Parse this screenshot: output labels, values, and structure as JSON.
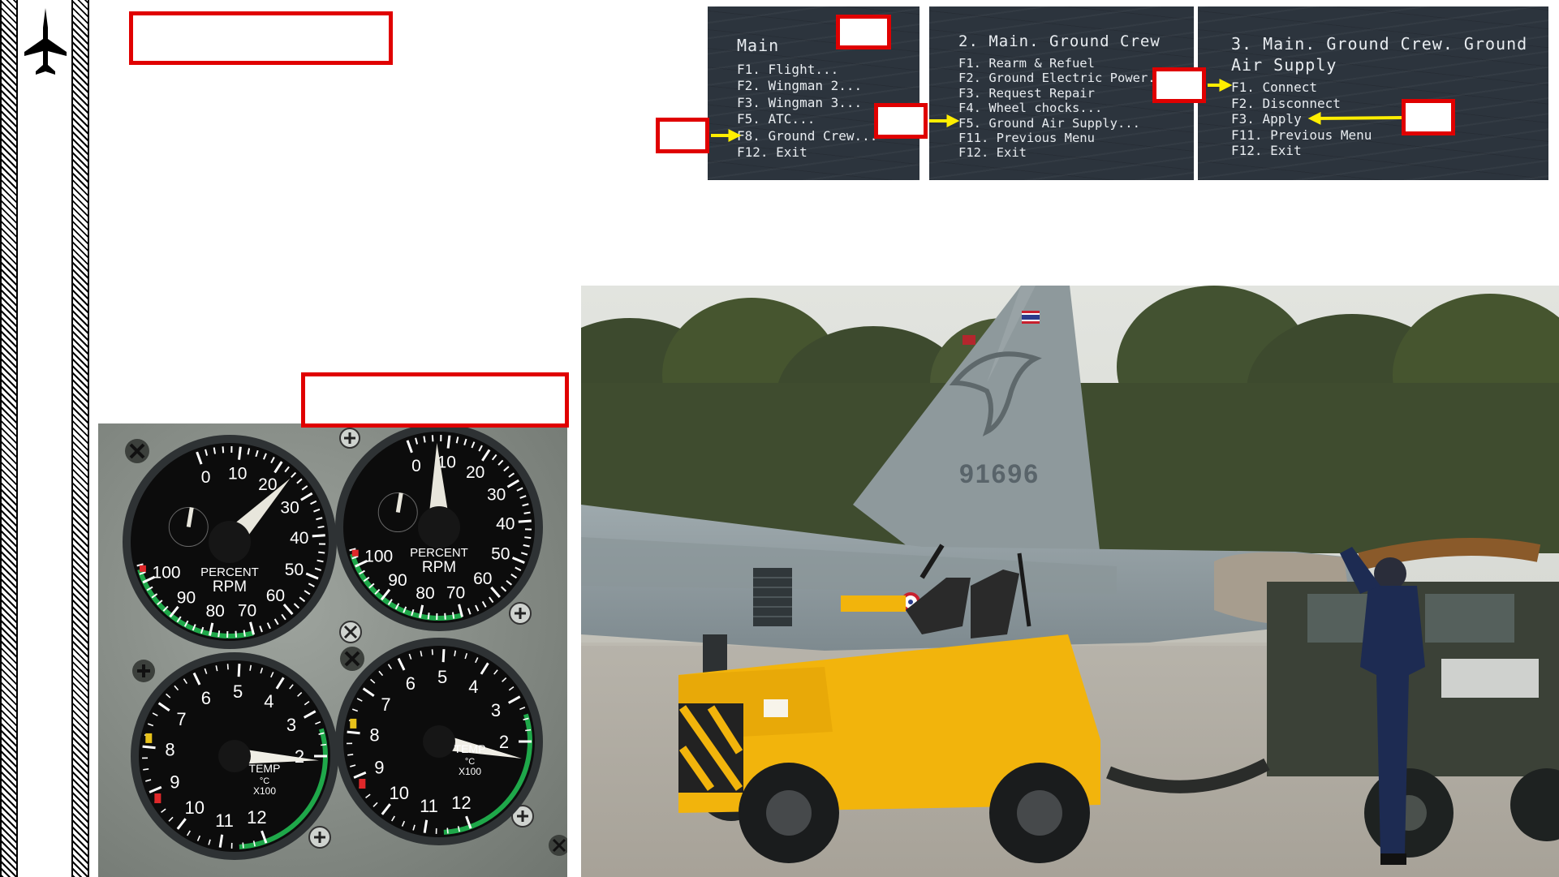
{
  "sidebar": {
    "icon": "jet-aircraft-icon"
  },
  "menus": [
    {
      "title": "Main",
      "items": [
        "F1. Flight...",
        "F2. Wingman 2...",
        "F3. Wingman 3...",
        "F5. ATC...",
        "F8. Ground Crew...",
        "F12. Exit"
      ]
    },
    {
      "title": "2. Main. Ground Crew",
      "items": [
        "F1. Rearm & Refuel",
        "F2. Ground Electric Power...",
        "F3. Request Repair",
        "F4. Wheel chocks...",
        "F5. Ground Air Supply...",
        "F11. Previous Menu",
        "F12. Exit"
      ]
    },
    {
      "title_line1": "3. Main. Ground Crew. Ground",
      "title_line2": "Air Supply",
      "items": [
        "F1. Connect",
        "F2. Disconnect",
        "F3. Apply",
        "F11. Previous Menu",
        "F12. Exit"
      ]
    }
  ],
  "gauges": {
    "rpm_label_1": "PERCENT",
    "rpm_label_2": "RPM",
    "rpm_ticks": [
      "0",
      "10",
      "20",
      "30",
      "40",
      "50",
      "60",
      "70",
      "80",
      "90",
      "100"
    ],
    "temp_label_1": "TEMP",
    "temp_label_2": "°C",
    "temp_label_3": "X100",
    "temp_ticks": [
      "2",
      "3",
      "4",
      "5",
      "6",
      "7",
      "8",
      "9",
      "10",
      "11",
      "12"
    ],
    "rpm_left_value": 24,
    "rpm_right_value": 7,
    "temp_left_value": 1.9,
    "temp_right_value": 1.6
  },
  "photo": {
    "tail_number": "91696"
  },
  "colors": {
    "callout_red": "#e00000",
    "arrow_yellow": "#ffee00",
    "tug_yellow": "#f2b40c",
    "gauge_green": "#1fa84a"
  }
}
